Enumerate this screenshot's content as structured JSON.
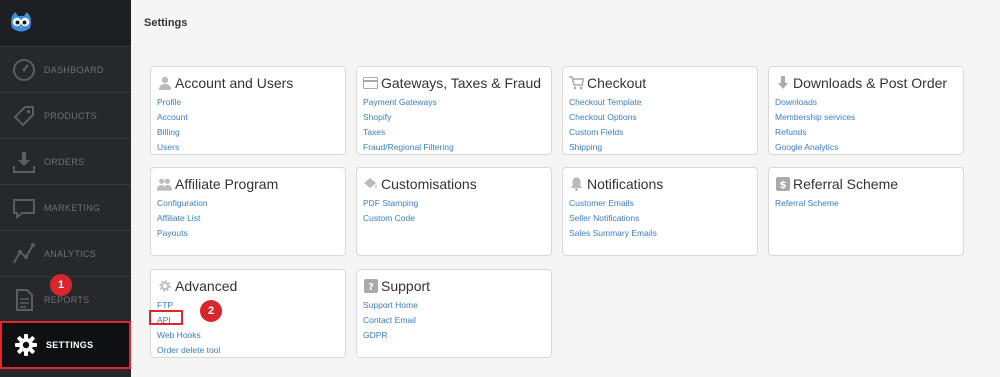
{
  "sidebar": {
    "logo": "owl-logo",
    "items": [
      {
        "label": "DASHBOARD",
        "icon": "speedometer-icon"
      },
      {
        "label": "PRODUCTS",
        "icon": "tag-icon"
      },
      {
        "label": "ORDERS",
        "icon": "download-tray-icon"
      },
      {
        "label": "MARKETING",
        "icon": "chat-bubble-icon"
      },
      {
        "label": "ANALYTICS",
        "icon": "line-chart-icon"
      },
      {
        "label": "REPORTS",
        "icon": "document-icon"
      },
      {
        "label": "SETTINGS",
        "icon": "gear-icon"
      }
    ],
    "active": "SETTINGS"
  },
  "annotations": {
    "step1": "1",
    "step2": "2"
  },
  "main": {
    "title": "Settings",
    "cards": [
      {
        "title": "Account and Users",
        "icon": "user-icon",
        "links": [
          "Profile",
          "Account",
          "Billing",
          "Users"
        ]
      },
      {
        "title": "Gateways, Taxes & Fraud",
        "icon": "credit-card-icon",
        "links": [
          "Payment Gateways",
          "Shopify",
          "Taxes",
          "Fraud/Regional Filtering"
        ]
      },
      {
        "title": "Checkout",
        "icon": "cart-icon",
        "links": [
          "Checkout Template",
          "Checkout Options",
          "Custom Fields",
          "Shipping"
        ]
      },
      {
        "title": "Downloads & Post Order",
        "icon": "download-arrow-icon",
        "links": [
          "Downloads",
          "Membership services",
          "Refunds",
          "Google Analytics"
        ]
      },
      {
        "title": "Affiliate Program",
        "icon": "users-icon",
        "links": [
          "Configuration",
          "Affiliate List",
          "Payouts"
        ]
      },
      {
        "title": "Customisations",
        "icon": "paint-bucket-icon",
        "links": [
          "PDF Stamping",
          "Custom Code"
        ]
      },
      {
        "title": "Notifications",
        "icon": "bell-icon",
        "links": [
          "Customer Emails",
          "Seller Notifications",
          "Sales Summary Emails"
        ]
      },
      {
        "title": "Referral Scheme",
        "icon": "dollar-icon",
        "links": [
          "Referral Scheme"
        ]
      },
      {
        "title": "Advanced",
        "icon": "cog-icon",
        "links": [
          "FTP",
          "API",
          "Web Hooks",
          "Order delete tool"
        ]
      },
      {
        "title": "Support",
        "icon": "question-icon",
        "links": [
          "Support Home",
          "Contact Email",
          "GDPR"
        ]
      }
    ]
  },
  "colors": {
    "accent": "#e0262e",
    "link": "#3b7dc4",
    "sidebar": "#26282c"
  }
}
